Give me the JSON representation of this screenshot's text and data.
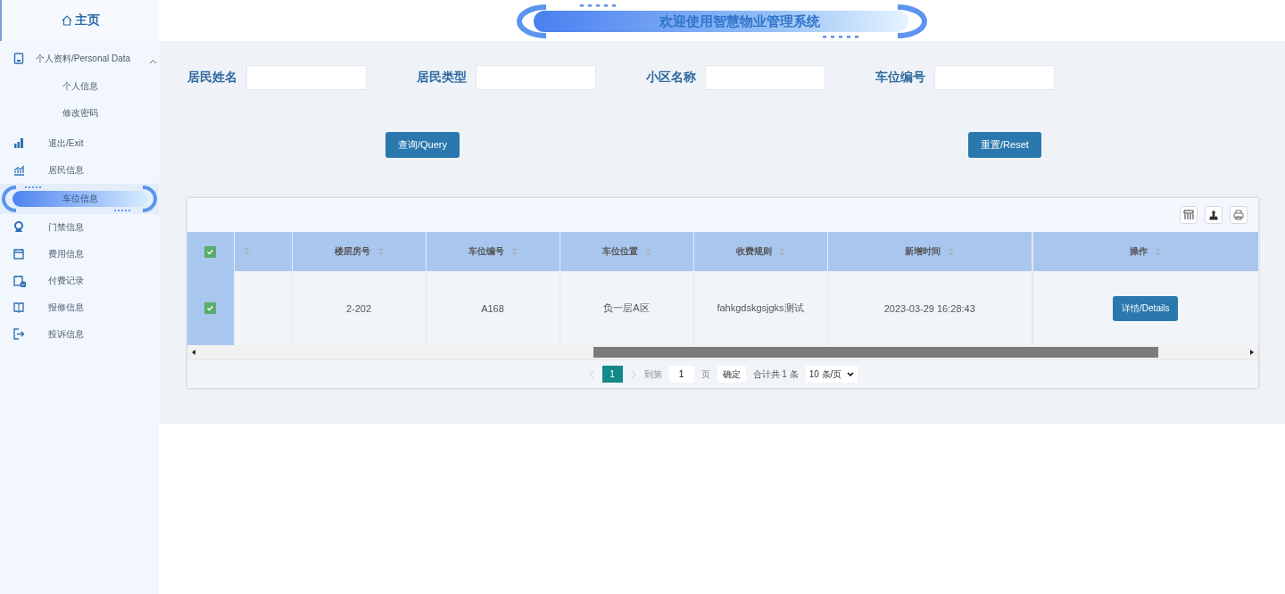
{
  "sidebar": {
    "home": "主页",
    "menu": [
      {
        "label": "个人资料/Personal Data",
        "selected": false,
        "expanded": true,
        "children": [
          {
            "label": "个人信息",
            "selected": false
          },
          {
            "label": "修改密码",
            "selected": false
          }
        ]
      },
      {
        "label": "退出/Exit",
        "selected": false
      },
      {
        "label": "居民信息",
        "selected": false
      },
      {
        "label": "车位信息",
        "selected": true
      },
      {
        "label": "门禁信息",
        "selected": false
      },
      {
        "label": "费用信息",
        "selected": false
      },
      {
        "label": "付费记录",
        "selected": false
      },
      {
        "label": "报修信息",
        "selected": false
      },
      {
        "label": "投诉信息",
        "selected": false
      }
    ]
  },
  "header": {
    "title": "欢迎使用智慧物业管理系统"
  },
  "search": {
    "fields": [
      {
        "label": "居民姓名"
      },
      {
        "label": "居民类型"
      },
      {
        "label": "小区名称"
      },
      {
        "label": "车位编号"
      }
    ],
    "buttons": [
      "查询/Query",
      "重置/Reset"
    ]
  },
  "table": {
    "all_checked": true,
    "columns": [
      {
        "kind": "cut"
      },
      {
        "kind": "text",
        "label": "楼层房号"
      },
      {
        "kind": "text",
        "label": "车位编号"
      },
      {
        "kind": "text",
        "label": "车位位置"
      },
      {
        "kind": "text",
        "label": "收费规则"
      },
      {
        "kind": "wide",
        "label": "新增时间"
      },
      {
        "kind": "action",
        "label": "操作"
      }
    ],
    "rows": [
      {
        "checked": true,
        "cells": [
          "",
          "2-202",
          "A168",
          "负一层A区",
          "fahkgdskgsjgks测试",
          "2023-03-29 16:28:43"
        ],
        "action": "详情/Details"
      }
    ]
  },
  "pagination": {
    "pages": [
      {
        "label": "1",
        "selected": true
      }
    ],
    "goto_label": "到第",
    "goto_value": "1",
    "page_unit": "页",
    "confirm": "确定",
    "total": "合计共 1 条",
    "page_size": "10 条/页"
  }
}
